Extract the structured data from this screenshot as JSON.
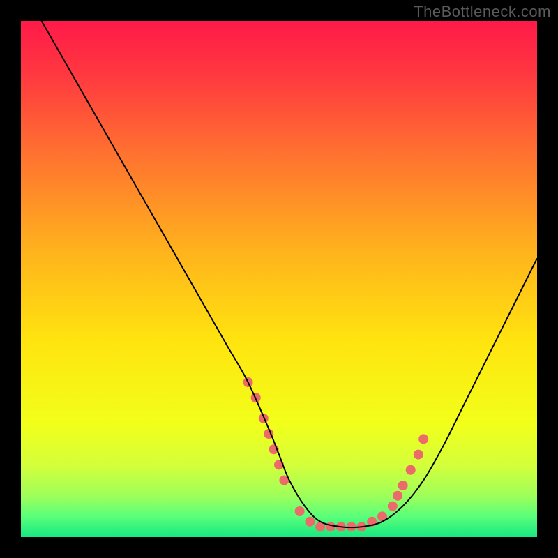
{
  "watermark": "TheBottleneck.com",
  "chart_data": {
    "type": "line",
    "title": "",
    "xlabel": "",
    "ylabel": "",
    "xlim": [
      0,
      100
    ],
    "ylim": [
      0,
      100
    ],
    "grid": false,
    "legend": false,
    "background_gradient": {
      "stops": [
        {
          "offset": 0.0,
          "color": "#ff1a49"
        },
        {
          "offset": 0.1,
          "color": "#ff3740"
        },
        {
          "offset": 0.25,
          "color": "#ff6f31"
        },
        {
          "offset": 0.45,
          "color": "#ffb41c"
        },
        {
          "offset": 0.62,
          "color": "#ffe40f"
        },
        {
          "offset": 0.78,
          "color": "#f2ff1a"
        },
        {
          "offset": 0.86,
          "color": "#d4ff3a"
        },
        {
          "offset": 0.92,
          "color": "#9eff5a"
        },
        {
          "offset": 0.96,
          "color": "#5aff7a"
        },
        {
          "offset": 1.0,
          "color": "#17e880"
        }
      ]
    },
    "series": [
      {
        "name": "bottleneck-curve",
        "color": "#000000",
        "x": [
          4,
          8,
          12,
          16,
          20,
          24,
          28,
          32,
          36,
          40,
          44,
          48,
          50,
          52,
          55,
          58,
          62,
          66,
          70,
          74,
          78,
          82,
          86,
          90,
          94,
          98,
          100
        ],
        "y": [
          100,
          93,
          86,
          79,
          72,
          65,
          58,
          51,
          44,
          37,
          30,
          21,
          16,
          11,
          6,
          3,
          2,
          2,
          3,
          6,
          11,
          18,
          26,
          34,
          42,
          50,
          54
        ]
      }
    ],
    "highlight_points": {
      "name": "optimal-range-dots",
      "color": "#ec6a6a",
      "radius_px": 7,
      "points": [
        {
          "x": 44,
          "y": 30
        },
        {
          "x": 45.5,
          "y": 27
        },
        {
          "x": 47,
          "y": 23
        },
        {
          "x": 48,
          "y": 20
        },
        {
          "x": 49,
          "y": 17
        },
        {
          "x": 50,
          "y": 14
        },
        {
          "x": 51,
          "y": 11
        },
        {
          "x": 54,
          "y": 5
        },
        {
          "x": 56,
          "y": 3
        },
        {
          "x": 58,
          "y": 2
        },
        {
          "x": 60,
          "y": 2
        },
        {
          "x": 62,
          "y": 2
        },
        {
          "x": 64,
          "y": 2
        },
        {
          "x": 66,
          "y": 2
        },
        {
          "x": 68,
          "y": 3
        },
        {
          "x": 70,
          "y": 4
        },
        {
          "x": 72,
          "y": 6
        },
        {
          "x": 73,
          "y": 8
        },
        {
          "x": 74,
          "y": 10
        },
        {
          "x": 75.5,
          "y": 13
        },
        {
          "x": 77,
          "y": 16
        },
        {
          "x": 78,
          "y": 19
        }
      ]
    }
  }
}
